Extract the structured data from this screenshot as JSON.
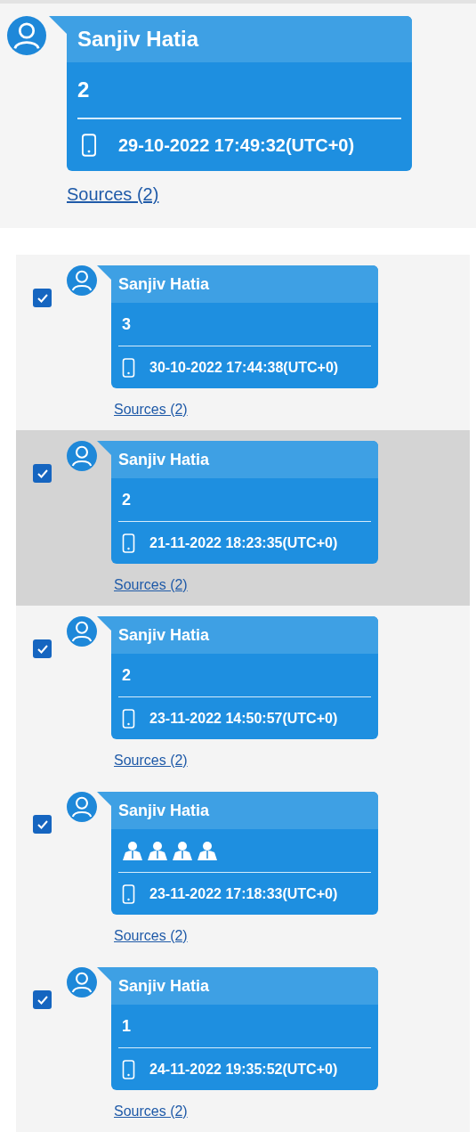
{
  "top_message": {
    "sender": "Sanjiv Hatia",
    "body": {
      "kind": "text",
      "text": "2"
    },
    "timestamp": "29-10-2022 17:49:32(UTC+0)",
    "sources_link": "Sources (2)"
  },
  "messages": [
    {
      "selected": false,
      "checked": true,
      "sender": "Sanjiv Hatia",
      "body": {
        "kind": "text",
        "text": "3"
      },
      "timestamp": "30-10-2022 17:44:38(UTC+0)",
      "sources_link": "Sources (2)"
    },
    {
      "selected": true,
      "checked": true,
      "sender": "Sanjiv Hatia",
      "body": {
        "kind": "text",
        "text": "2"
      },
      "timestamp": "21-11-2022 18:23:35(UTC+0)",
      "sources_link": "Sources (2)"
    },
    {
      "selected": false,
      "checked": true,
      "sender": "Sanjiv Hatia",
      "body": {
        "kind": "text",
        "text": "2"
      },
      "timestamp": "23-11-2022 14:50:57(UTC+0)",
      "sources_link": "Sources (2)"
    },
    {
      "selected": false,
      "checked": true,
      "sender": "Sanjiv Hatia",
      "body": {
        "kind": "icons",
        "icons": [
          {
            "kind": "person"
          },
          {
            "kind": "person"
          },
          {
            "kind": "person"
          },
          {
            "kind": "person"
          }
        ]
      },
      "timestamp": "23-11-2022 17:18:33(UTC+0)",
      "sources_link": "Sources (2)"
    },
    {
      "selected": false,
      "checked": true,
      "sender": "Sanjiv Hatia",
      "body": {
        "kind": "text",
        "text": "1"
      },
      "timestamp": "24-11-2022 19:35:52(UTC+0)",
      "sources_link": "Sources (2)"
    }
  ]
}
